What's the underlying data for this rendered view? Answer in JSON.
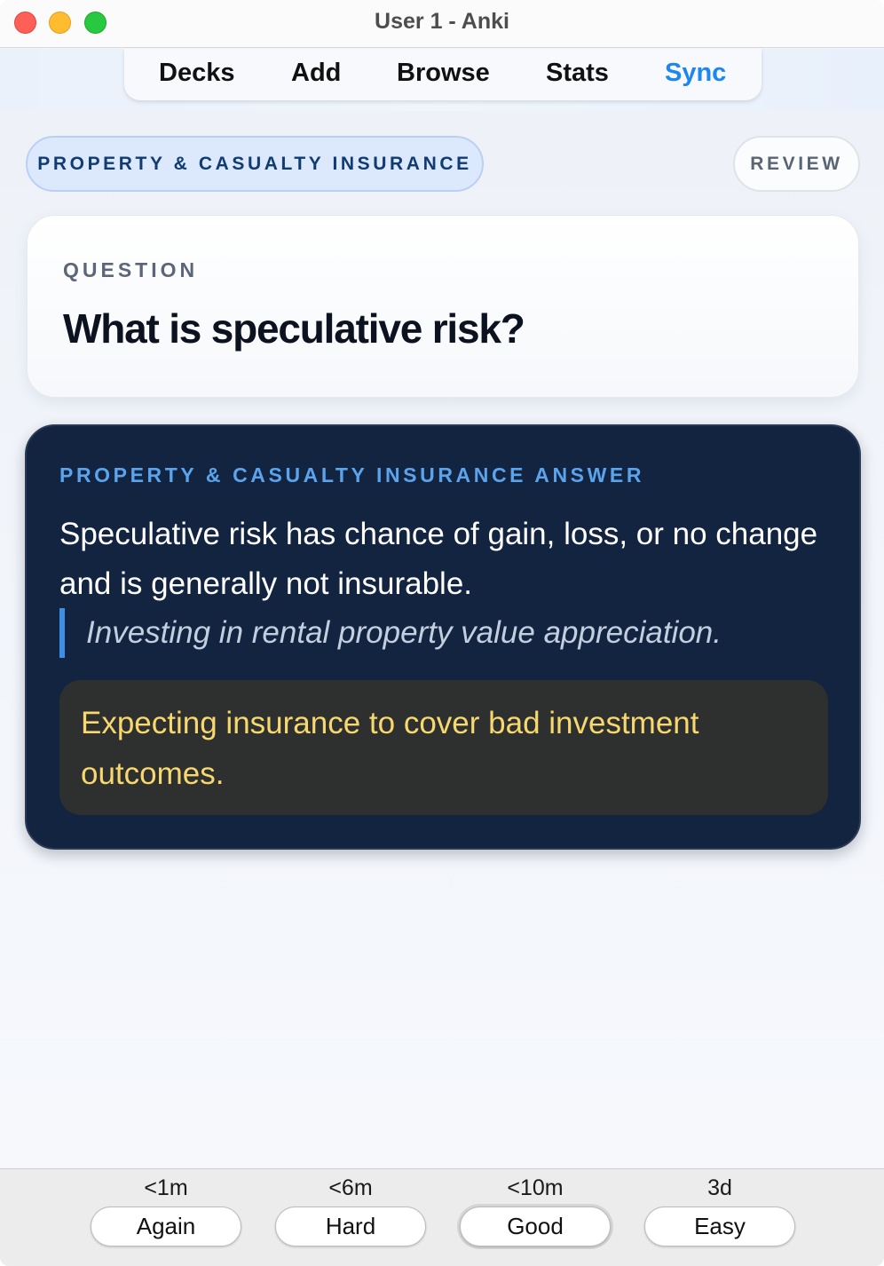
{
  "window": {
    "title": "User 1 - Anki"
  },
  "nav": {
    "items": [
      {
        "label": "Decks"
      },
      {
        "label": "Add"
      },
      {
        "label": "Browse"
      },
      {
        "label": "Stats"
      },
      {
        "label": "Sync",
        "color": "#1e86f0"
      }
    ]
  },
  "card": {
    "deck_name": "PROPERTY & CASUALTY INSURANCE",
    "mode_label": "REVIEW",
    "question_label": "QUESTION",
    "question_text": "What is speculative risk?",
    "answer_label": "PROPERTY & CASUALTY INSURANCE ANSWER",
    "answer_text": "Speculative risk has chance of gain, loss, or no change and is generally not insurable.",
    "example_text": "Investing in rental property value appreciation.",
    "note_text": "Expecting insurance to cover bad investment outcomes."
  },
  "ease_buttons": [
    {
      "interval": "<1m",
      "label": "Again"
    },
    {
      "interval": "<6m",
      "label": "Hard"
    },
    {
      "interval": "<10m",
      "label": "Good",
      "default": true
    },
    {
      "interval": "3d",
      "label": "Easy"
    }
  ],
  "colors": {
    "accent": "#1e86f0",
    "answer_bg": "#132441",
    "note_text": "#f6d86e"
  }
}
